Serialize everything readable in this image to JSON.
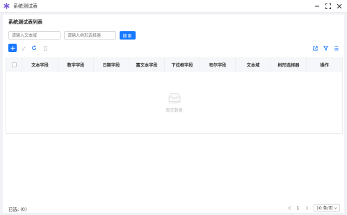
{
  "window": {
    "title": "系统测试表",
    "icon": "purple-asterisk-icon"
  },
  "panel": {
    "title": "系统测试表列表"
  },
  "search": {
    "text_placeholder": "请输入文本域",
    "tree_placeholder": "请输入树形选择器",
    "button_label": "搜索"
  },
  "toolbar": {
    "add": "plus-icon",
    "edit": "edit-icon",
    "refresh": "refresh-icon",
    "delete": "delete-icon",
    "export": "export-icon",
    "filter": "filter-icon",
    "columns": "columns-icon"
  },
  "table": {
    "columns": [
      "文本字段",
      "数字字段",
      "日期字段",
      "富文本字段",
      "下拉框字段",
      "布尔字段",
      "文本域",
      "树形选择器",
      "操作"
    ],
    "empty_text": "暂无数据"
  },
  "footer": {
    "selected": "已选: (0)",
    "page": "1",
    "page_size": "10 条/页"
  },
  "colors": {
    "primary": "#1677ff",
    "title_icon": "#7b5cd6"
  }
}
